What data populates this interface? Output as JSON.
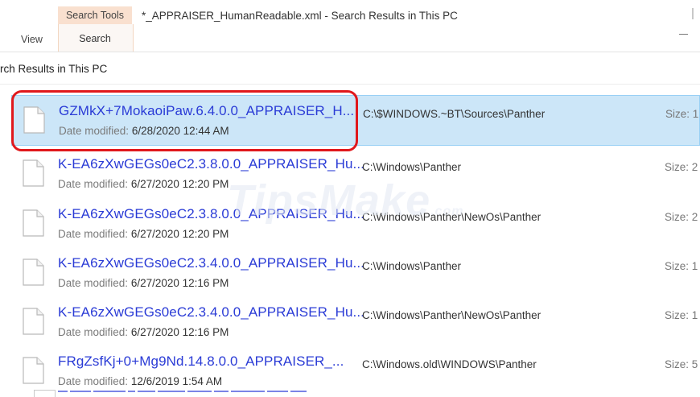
{
  "ribbon": {
    "contextual_group": "Search Tools",
    "tabs": [
      {
        "label": "View"
      },
      {
        "label": "Search"
      }
    ]
  },
  "window": {
    "title": "*_APPRAISER_HumanReadable.xml - Search Results in This PC"
  },
  "breadcrumb": {
    "text": "rch Results in This PC"
  },
  "results": {
    "date_label": "Date modified:",
    "size_label": "Size:",
    "items": [
      {
        "name": "GZMkX+7MokaoiPaw.6.4.0.0_APPRAISER_H...",
        "date": "6/28/2020 12:44 AM",
        "path": "C:\\$WINDOWS.~BT\\Sources\\Panther",
        "size": "1",
        "selected": true
      },
      {
        "name": "K-EA6zXwGEGs0eC2.3.8.0.0_APPRAISER_Hu...",
        "date": "6/27/2020 12:20 PM",
        "path": "C:\\Windows\\Panther",
        "size": "2",
        "selected": false
      },
      {
        "name": "K-EA6zXwGEGs0eC2.3.8.0.0_APPRAISER_Hu...",
        "date": "6/27/2020 12:20 PM",
        "path": "C:\\Windows\\Panther\\NewOs\\Panther",
        "size": "2",
        "selected": false
      },
      {
        "name": "K-EA6zXwGEGs0eC2.3.4.0.0_APPRAISER_Hu...",
        "date": "6/27/2020 12:16 PM",
        "path": "C:\\Windows\\Panther",
        "size": "1",
        "selected": false
      },
      {
        "name": "K-EA6zXwGEGs0eC2.3.4.0.0_APPRAISER_Hu...",
        "date": "6/27/2020 12:16 PM",
        "path": "C:\\Windows\\Panther\\NewOs\\Panther",
        "size": "1",
        "selected": false
      },
      {
        "name": "FRgZsfKj+0+Mg9Nd.14.8.0.0_APPRAISER_...",
        "date": "12/6/2019 1:54 AM",
        "path": "C:\\Windows.old\\WINDOWS\\Panther",
        "size": "5",
        "selected": false
      }
    ]
  },
  "watermark": {
    "brand": "TipsMake",
    "suffix": ".com"
  },
  "colors": {
    "accent_selection": "#cce6f8",
    "link_blue": "#2a3bd6",
    "highlight_red": "#e0181c",
    "search_tools_tab": "#f9e0cf"
  }
}
